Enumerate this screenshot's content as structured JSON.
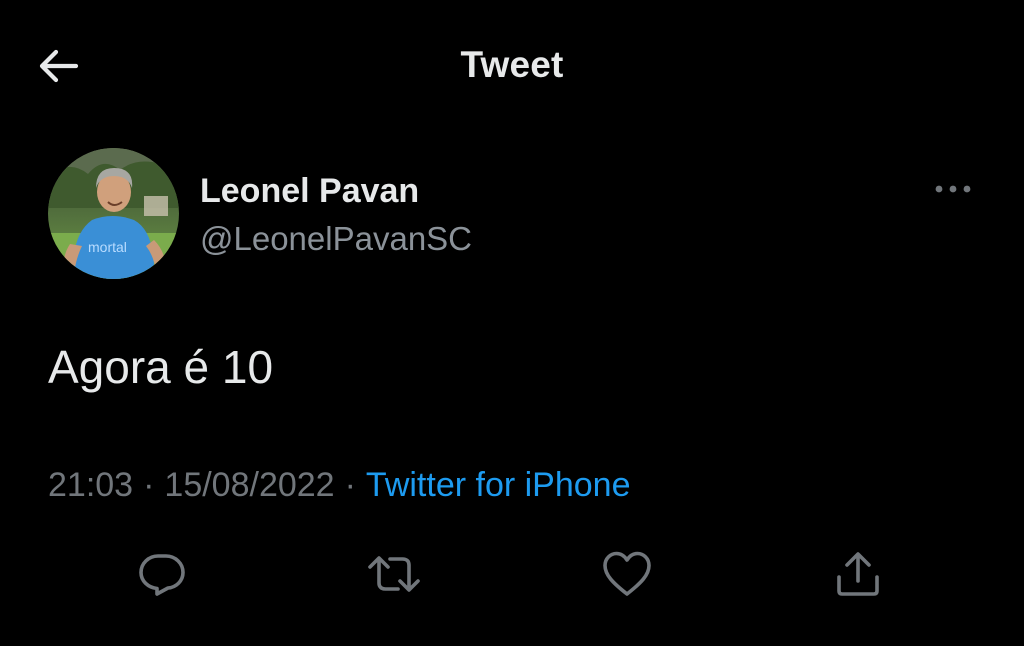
{
  "header": {
    "title": "Tweet",
    "back_icon": "arrow-left-icon"
  },
  "author": {
    "name": "Leonel Pavan",
    "handle": "@LeonelPavanSC",
    "shirt_text": "mortal",
    "more_icon": "more-horizontal-icon"
  },
  "tweet": {
    "text": "Agora é 10"
  },
  "meta": {
    "time": "21:03",
    "separator": "·",
    "date": "15/08/2022",
    "source": "Twitter for iPhone"
  },
  "actions": {
    "reply_icon": "reply-icon",
    "retweet_icon": "retweet-icon",
    "like_icon": "heart-icon",
    "share_icon": "share-icon"
  },
  "colors": {
    "background": "#000000",
    "text_primary": "#e7e9ea",
    "text_secondary": "#71767b",
    "link": "#1d9bf0",
    "icon": "#71767b"
  }
}
